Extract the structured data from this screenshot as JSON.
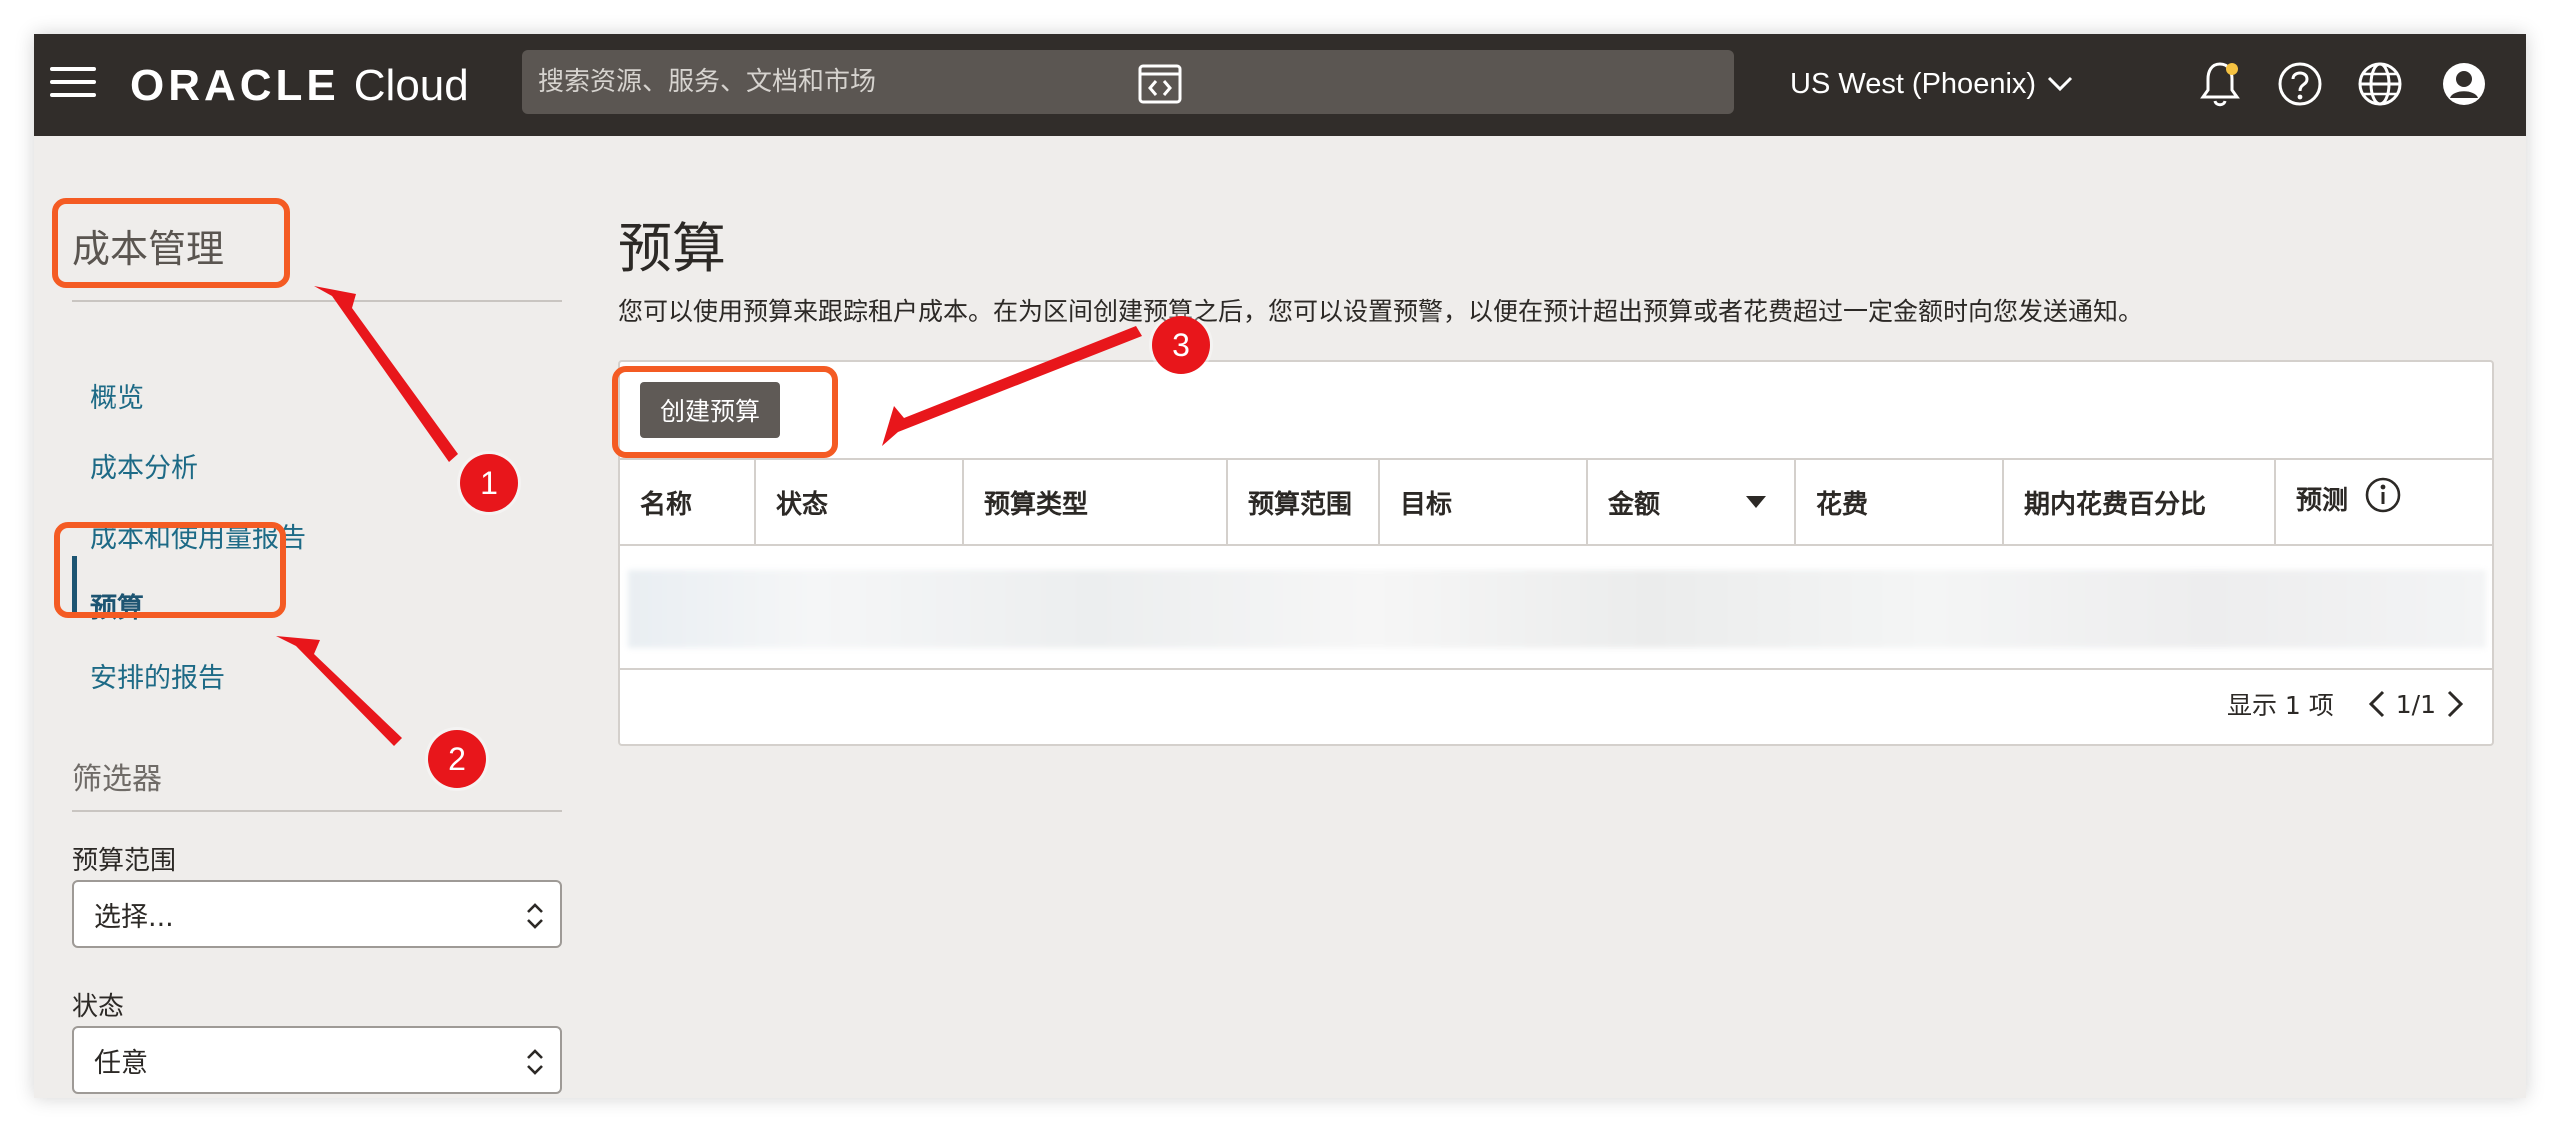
{
  "topbar": {
    "logo_oracle": "ORACLE",
    "logo_cloud": "Cloud",
    "search_placeholder": "搜索资源、服务、文档和市场",
    "region": "US West (Phoenix)",
    "icons": [
      "hamburger-menu-icon",
      "code-editor-icon",
      "notification-bell-icon",
      "help-icon",
      "globe-icon",
      "user-avatar-icon"
    ]
  },
  "sidebar": {
    "title": "成本管理",
    "items": [
      {
        "label": "概览"
      },
      {
        "label": "成本分析"
      },
      {
        "label": "成本和使用量报告"
      },
      {
        "label": "预算"
      },
      {
        "label": "安排的报告"
      }
    ],
    "active_index": 3,
    "filter_title": "筛选器",
    "filters": [
      {
        "label": "预算范围",
        "value": "选择..."
      },
      {
        "label": "状态",
        "value": "任意"
      }
    ]
  },
  "main": {
    "title": "预算",
    "description": "您可以使用预算来跟踪租户成本。在为区间创建预算之后，您可以设置预警，以便在预计超出预算或者花费超过一定金额时向您发送通知。",
    "create_button": "创建预算",
    "columns": [
      "名称",
      "状态",
      "预算类型",
      "预算范围",
      "目标",
      "金额",
      "花费",
      "期内花费百分比",
      "预测"
    ],
    "pager": {
      "summary": "显示 1 项",
      "page": "1/1"
    }
  },
  "annotations": {
    "badges": [
      "1",
      "2",
      "3"
    ],
    "color": "#f45b23"
  }
}
